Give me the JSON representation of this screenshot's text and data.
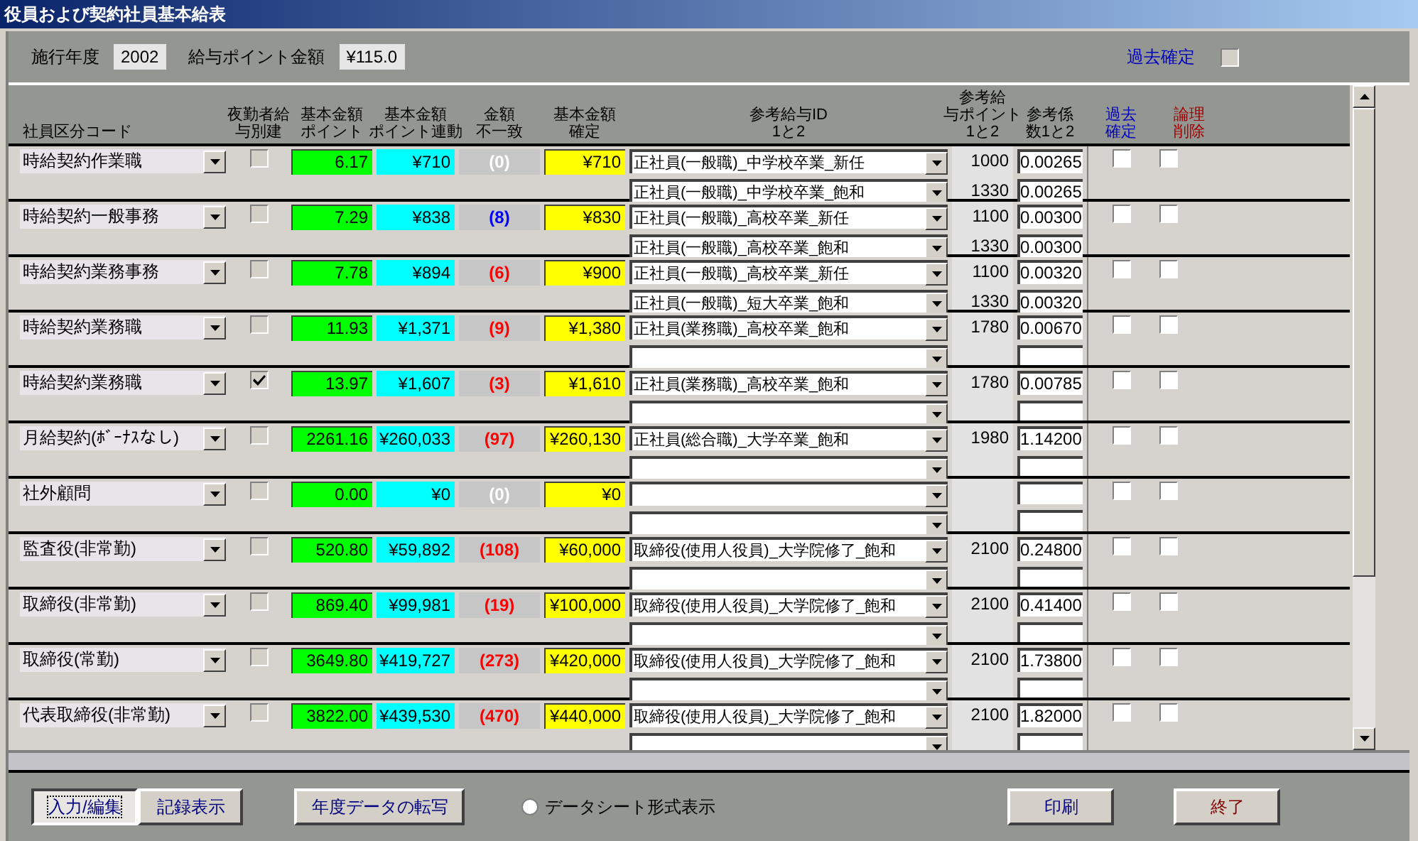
{
  "window": {
    "title": "役員および契約社員基本給表"
  },
  "settings": {
    "year_label": "施行年度",
    "year": "2002",
    "point_label": "給与ポイント金額",
    "point_value": "¥115.0",
    "past_label": "過去確定",
    "past_checked": false
  },
  "columns": [
    {
      "lines": [
        "社員区分コード"
      ]
    },
    {
      "lines": [
        "夜勤者給",
        "与別建"
      ]
    },
    {
      "lines": [
        "基本金額",
        "ポイント"
      ]
    },
    {
      "lines": [
        "基本金額",
        "ポイント連動"
      ]
    },
    {
      "lines": [
        "金額",
        "不一致"
      ]
    },
    {
      "lines": [
        "基本金額",
        "確定"
      ]
    },
    {
      "lines": [
        "参考給与ID",
        "1と2"
      ]
    },
    {
      "lines": [
        "参考給",
        "与ポイント",
        "1と2"
      ]
    },
    {
      "lines": [
        "参考係",
        "数1と2"
      ]
    },
    {
      "lines": [
        "過去",
        "確定"
      ],
      "color": "#0000c0"
    },
    {
      "lines": [
        "論理",
        "削除"
      ],
      "color": "#a00000"
    }
  ],
  "rows": [
    {
      "code": "時給契約作業職",
      "night_separate": false,
      "points": "6.17",
      "linked": "¥710",
      "diff": {
        "text": "(0)",
        "color": "#ffffff"
      },
      "confirmed": "¥710",
      "refs": [
        {
          "id": "正社員(一般職)_中学校卒業_新任",
          "points": "1000",
          "coef": "0.00265"
        },
        {
          "id": "正社員(一般職)_中学校卒業_飽和",
          "points": "1330",
          "coef": "0.00265"
        }
      ],
      "past_confirmed": false,
      "deleted": false
    },
    {
      "code": "時給契約一般事務",
      "night_separate": false,
      "points": "7.29",
      "linked": "¥838",
      "diff": {
        "text": "(8)",
        "color": "#0000ff"
      },
      "confirmed": "¥830",
      "refs": [
        {
          "id": "正社員(一般職)_高校卒業_新任",
          "points": "1100",
          "coef": "0.00300"
        },
        {
          "id": "正社員(一般職)_高校卒業_飽和",
          "points": "1330",
          "coef": "0.00300"
        }
      ],
      "past_confirmed": false,
      "deleted": false
    },
    {
      "code": "時給契約業務事務",
      "night_separate": false,
      "points": "7.78",
      "linked": "¥894",
      "diff": {
        "text": "(6)",
        "color": "#ff0000"
      },
      "confirmed": "¥900",
      "refs": [
        {
          "id": "正社員(一般職)_高校卒業_新任",
          "points": "1100",
          "coef": "0.00320"
        },
        {
          "id": "正社員(一般職)_短大卒業_飽和",
          "points": "1330",
          "coef": "0.00320"
        }
      ],
      "past_confirmed": false,
      "deleted": false
    },
    {
      "code": "時給契約業務職",
      "night_separate": false,
      "points": "11.93",
      "linked": "¥1,371",
      "diff": {
        "text": "(9)",
        "color": "#ff0000"
      },
      "confirmed": "¥1,380",
      "refs": [
        {
          "id": "正社員(業務職)_高校卒業_飽和",
          "points": "1780",
          "coef": "0.00670"
        }
      ],
      "past_confirmed": false,
      "deleted": false
    },
    {
      "code": "時給契約業務職",
      "night_separate": true,
      "points": "13.97",
      "linked": "¥1,607",
      "diff": {
        "text": "(3)",
        "color": "#ff0000"
      },
      "confirmed": "¥1,610",
      "refs": [
        {
          "id": "正社員(業務職)_高校卒業_飽和",
          "points": "1780",
          "coef": "0.00785"
        }
      ],
      "past_confirmed": false,
      "deleted": false
    },
    {
      "code": "月給契約(ﾎﾞｰﾅｽなし)",
      "night_separate": false,
      "points": "2261.16",
      "linked": "¥260,033",
      "diff": {
        "text": "(97)",
        "color": "#ff0000"
      },
      "confirmed": "¥260,130",
      "refs": [
        {
          "id": "正社員(総合職)_大学卒業_飽和",
          "points": "1980",
          "coef": "1.14200"
        }
      ],
      "past_confirmed": false,
      "deleted": false
    },
    {
      "code": "社外顧問",
      "night_separate": false,
      "points": "0.00",
      "linked": "¥0",
      "diff": {
        "text": "(0)",
        "color": "#ffffff"
      },
      "confirmed": "¥0",
      "past_confirmed": false,
      "deleted": false
    },
    {
      "code": "監査役(非常勤)",
      "night_separate": false,
      "points": "520.80",
      "linked": "¥59,892",
      "diff": {
        "text": "(108)",
        "color": "#ff0000"
      },
      "confirmed": "¥60,000",
      "refs": [
        {
          "id": "取締役(使用人役員)_大学院修了_飽和",
          "points": "2100",
          "coef": "0.24800"
        }
      ],
      "past_confirmed": false,
      "deleted": false
    },
    {
      "code": "取締役(非常勤)",
      "night_separate": false,
      "points": "869.40",
      "linked": "¥99,981",
      "diff": {
        "text": "(19)",
        "color": "#ff0000"
      },
      "confirmed": "¥100,000",
      "refs": [
        {
          "id": "取締役(使用人役員)_大学院修了_飽和",
          "points": "2100",
          "coef": "0.41400"
        }
      ],
      "past_confirmed": false,
      "deleted": false
    },
    {
      "code": "取締役(常勤)",
      "night_separate": false,
      "points": "3649.80",
      "linked": "¥419,727",
      "diff": {
        "text": "(273)",
        "color": "#ff0000"
      },
      "confirmed": "¥420,000",
      "refs": [
        {
          "id": "取締役(使用人役員)_大学院修了_飽和",
          "points": "2100",
          "coef": "1.73800"
        }
      ],
      "past_confirmed": false,
      "deleted": false
    },
    {
      "code": "代表取締役(非常勤)",
      "night_separate": false,
      "points": "3822.00",
      "linked": "¥439,530",
      "diff": {
        "text": "(470)",
        "color": "#ff0000"
      },
      "confirmed": "¥440,000",
      "refs": [
        {
          "id": "取締役(使用人役員)_大学院修了_飽和",
          "points": "2100",
          "coef": "1.82000"
        }
      ],
      "past_confirmed": false,
      "deleted": false
    }
  ],
  "footer": {
    "view_toggle": [
      {
        "label": "入力/編集",
        "selected": true
      },
      {
        "label": "記録表示",
        "selected": false
      }
    ],
    "copy_button": "年度データの転写",
    "datasheet_option": {
      "label": "データシート形式表示",
      "selected": false
    },
    "buttons": [
      {
        "label": "印刷",
        "color": "#000080"
      },
      {
        "label": "終了",
        "color": "#800000"
      }
    ]
  }
}
